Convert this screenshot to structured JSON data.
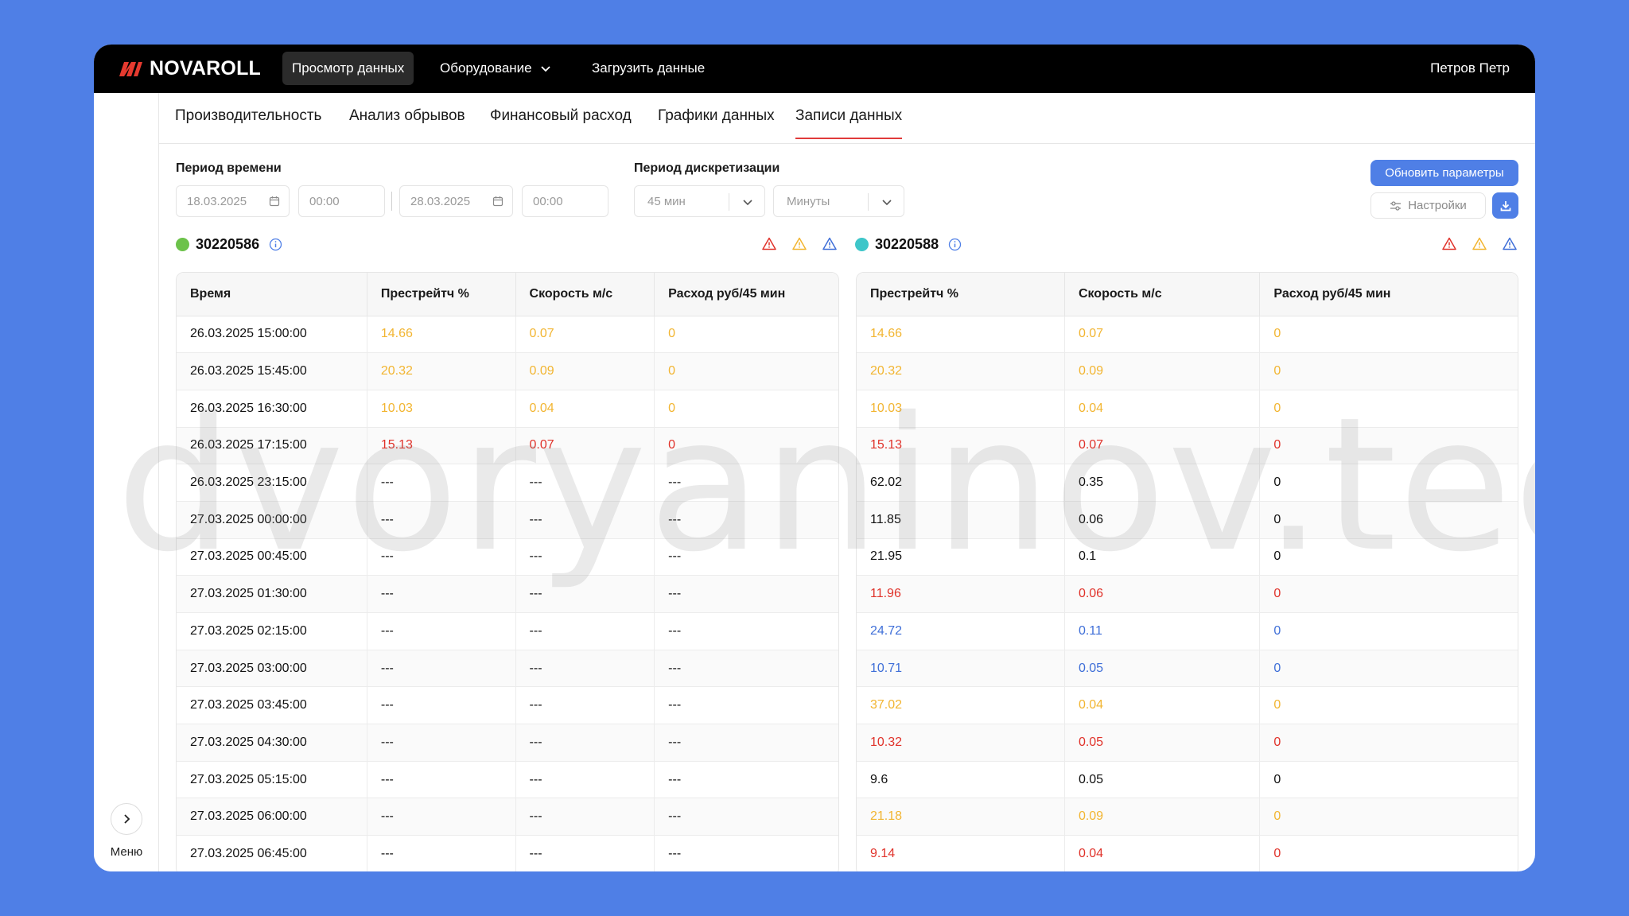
{
  "app": {
    "brand": "NOVAROLL",
    "user": "Петров Петр",
    "watermark": "dvoryaninov.tech"
  },
  "nav": [
    {
      "label": "Просмотр данных",
      "active": true
    },
    {
      "label": "Оборудование",
      "has_dropdown": true
    },
    {
      "label": "Загрузить данные"
    }
  ],
  "tabs": [
    {
      "label": "Производительность"
    },
    {
      "label": "Анализ обрывов"
    },
    {
      "label": "Финансовый расход"
    },
    {
      "label": "Графики данных"
    },
    {
      "label": "Записи данных",
      "active": true
    }
  ],
  "filters": {
    "period_label": "Период времени",
    "date_from": "18.03.2025",
    "time_from": "00:00",
    "date_to": "28.03.2025",
    "time_to": "00:00",
    "sampling_label": "Период дискретизации",
    "sampling_value": "45 мин",
    "sampling_unit": "Минуты",
    "update_button": "Обновить параметры",
    "settings_button": "Настройки"
  },
  "colors": {
    "accent": "#4f7fe6",
    "yellow": "#f2b531",
    "red": "#e0322a",
    "blue": "#3f6fd8",
    "green_dot": "#6cc24a",
    "teal_dot": "#3ec6c9"
  },
  "sidebar": {
    "menu_label": "Меню"
  },
  "left_device": {
    "id": "30220586",
    "status_color": "#6cc24a",
    "columns": [
      "Время",
      "Престрейтч %",
      "Скорость м/с",
      "Расход руб/45 мин"
    ],
    "rows": [
      {
        "time": "26.03.2025 15:00:00",
        "stretch": "14.66",
        "speed": "0.07",
        "cost": "0",
        "color": "yellow"
      },
      {
        "time": "26.03.2025 15:45:00",
        "stretch": "20.32",
        "speed": "0.09",
        "cost": "0",
        "color": "yellow"
      },
      {
        "time": "26.03.2025 16:30:00",
        "stretch": "10.03",
        "speed": "0.04",
        "cost": "0",
        "color": "yellow"
      },
      {
        "time": "26.03.2025 17:15:00",
        "stretch": "15.13",
        "speed": "0.07",
        "cost": "0",
        "color": "red"
      },
      {
        "time": "26.03.2025 23:15:00",
        "stretch": "---",
        "speed": "---",
        "cost": "---",
        "color": "black"
      },
      {
        "time": "27.03.2025 00:00:00",
        "stretch": "---",
        "speed": "---",
        "cost": "---",
        "color": "black"
      },
      {
        "time": "27.03.2025 00:45:00",
        "stretch": "---",
        "speed": "---",
        "cost": "---",
        "color": "black"
      },
      {
        "time": "27.03.2025 01:30:00",
        "stretch": "---",
        "speed": "---",
        "cost": "---",
        "color": "black"
      },
      {
        "time": "27.03.2025 02:15:00",
        "stretch": "---",
        "speed": "---",
        "cost": "---",
        "color": "black"
      },
      {
        "time": "27.03.2025 03:00:00",
        "stretch": "---",
        "speed": "---",
        "cost": "---",
        "color": "black"
      },
      {
        "time": "27.03.2025 03:45:00",
        "stretch": "---",
        "speed": "---",
        "cost": "---",
        "color": "black"
      },
      {
        "time": "27.03.2025 04:30:00",
        "stretch": "---",
        "speed": "---",
        "cost": "---",
        "color": "black"
      },
      {
        "time": "27.03.2025 05:15:00",
        "stretch": "---",
        "speed": "---",
        "cost": "---",
        "color": "black"
      },
      {
        "time": "27.03.2025 06:00:00",
        "stretch": "---",
        "speed": "---",
        "cost": "---",
        "color": "black"
      },
      {
        "time": "27.03.2025 06:45:00",
        "stretch": "---",
        "speed": "---",
        "cost": "---",
        "color": "black"
      }
    ]
  },
  "right_device": {
    "id": "30220588",
    "status_color": "#3ec6c9",
    "columns": [
      "Престрейтч %",
      "Скорость м/с",
      "Расход руб/45 мин"
    ],
    "rows": [
      {
        "stretch": "14.66",
        "speed": "0.07",
        "cost": "0",
        "color": "yellow"
      },
      {
        "stretch": "20.32",
        "speed": "0.09",
        "cost": "0",
        "color": "yellow"
      },
      {
        "stretch": "10.03",
        "speed": "0.04",
        "cost": "0",
        "color": "yellow"
      },
      {
        "stretch": "15.13",
        "speed": "0.07",
        "cost": "0",
        "color": "red"
      },
      {
        "stretch": "62.02",
        "speed": "0.35",
        "cost": "0",
        "color": "black"
      },
      {
        "stretch": "11.85",
        "speed": "0.06",
        "cost": "0",
        "color": "black"
      },
      {
        "stretch": "21.95",
        "speed": "0.1",
        "cost": "0",
        "color": "black"
      },
      {
        "stretch": "11.96",
        "speed": "0.06",
        "cost": "0",
        "color": "red"
      },
      {
        "stretch": "24.72",
        "speed": "0.11",
        "cost": "0",
        "color": "blue"
      },
      {
        "stretch": "10.71",
        "speed": "0.05",
        "cost": "0",
        "color": "blue"
      },
      {
        "stretch": "37.02",
        "speed": "0.04",
        "cost": "0",
        "color": "yellow"
      },
      {
        "stretch": "10.32",
        "speed": "0.05",
        "cost": "0",
        "color": "red"
      },
      {
        "stretch": "9.6",
        "speed": "0.05",
        "cost": "0",
        "color": "black"
      },
      {
        "stretch": "21.18",
        "speed": "0.09",
        "cost": "0",
        "color": "yellow"
      },
      {
        "stretch": "9.14",
        "speed": "0.04",
        "cost": "0",
        "color": "red"
      }
    ]
  }
}
